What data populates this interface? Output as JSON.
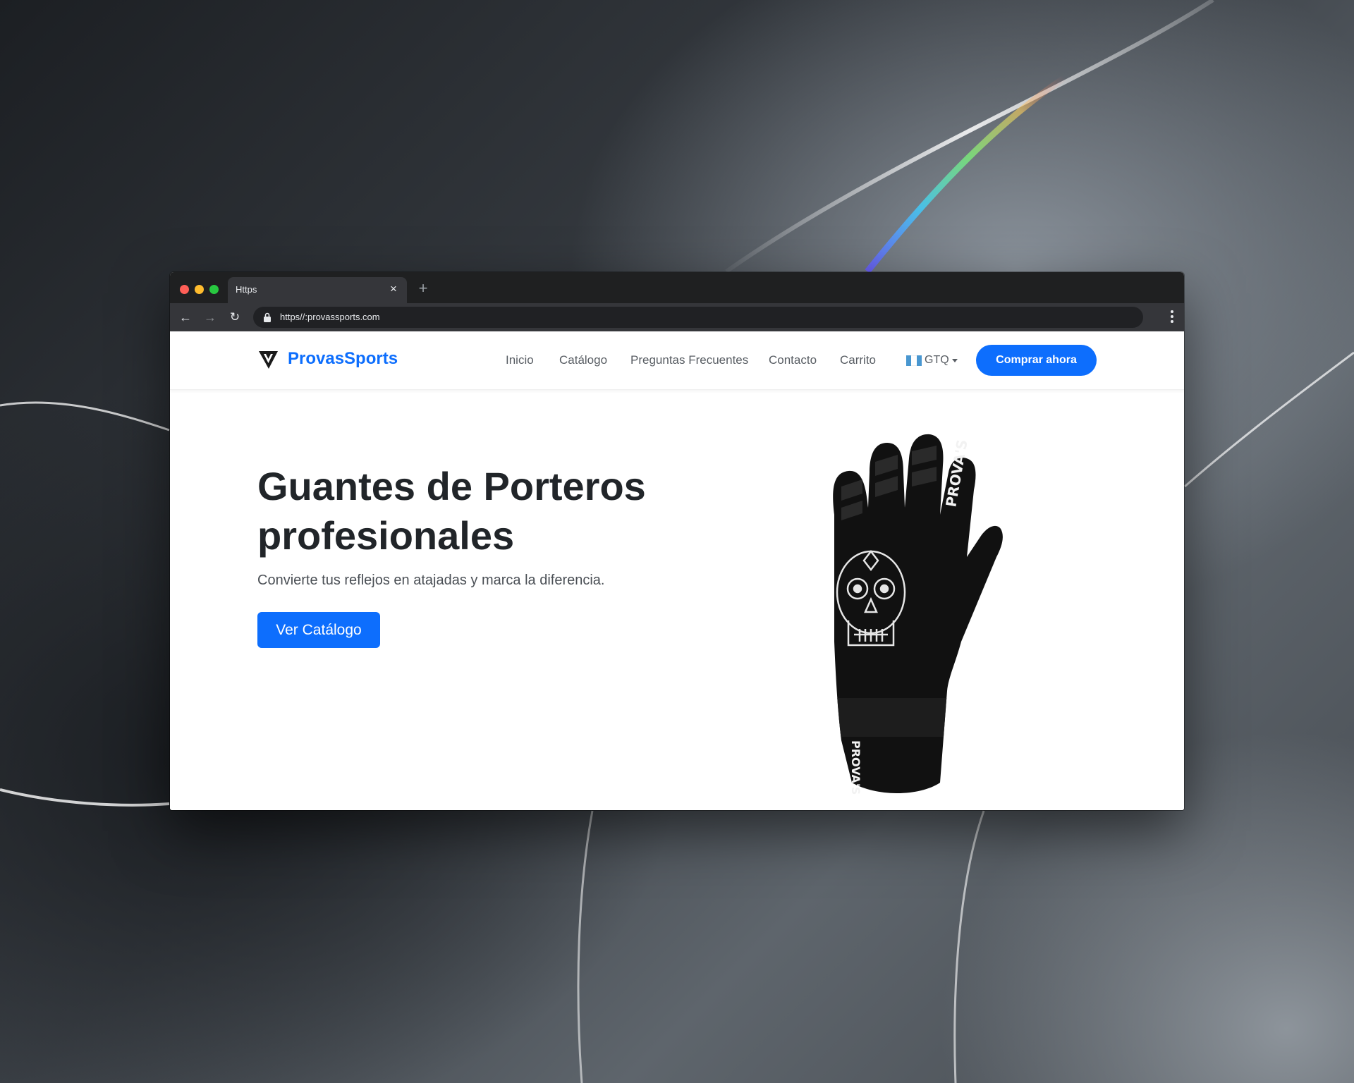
{
  "browser": {
    "tab_title": "Https",
    "url": "https//:provassports.com"
  },
  "site": {
    "brand": "ProvasSports",
    "nav": [
      "Inicio",
      "Catálogo",
      "Preguntas Frecuentes",
      "Contacto",
      "Carrito"
    ],
    "currency": "GTQ",
    "cta": "Comprar ahora"
  },
  "hero": {
    "title": "Guantes de Porteros profesionales",
    "subtitle": "Convierte tus reflejos en atajadas y marca la diferencia.",
    "button": "Ver Catálogo",
    "product_print": "PROVA'S"
  },
  "colors": {
    "accent": "#0d6efd",
    "text_dark": "#212529",
    "nav_text": "#585d63",
    "browser_chrome": "#35363a",
    "flag_blue": "#4997d0"
  }
}
